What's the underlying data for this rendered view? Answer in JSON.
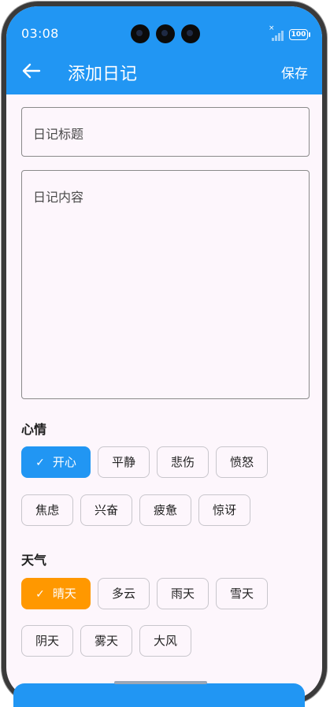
{
  "status": {
    "time": "03:08",
    "battery": "100"
  },
  "appbar": {
    "title": "添加日记",
    "save_label": "保存"
  },
  "form": {
    "title_placeholder": "日记标题",
    "content_placeholder": "日记内容"
  },
  "mood": {
    "label": "心情",
    "options": [
      "开心",
      "平静",
      "悲伤",
      "愤怒",
      "焦虑",
      "兴奋",
      "疲惫",
      "惊讶"
    ],
    "selected": "开心",
    "selected_color": "#2196f3"
  },
  "weather": {
    "label": "天气",
    "options": [
      "晴天",
      "多云",
      "雨天",
      "雪天",
      "阴天",
      "雾天",
      "大风"
    ],
    "selected": "晴天",
    "selected_color": "#ff9800"
  },
  "colors": {
    "primary": "#2196f3",
    "background": "#fdf6fc"
  }
}
